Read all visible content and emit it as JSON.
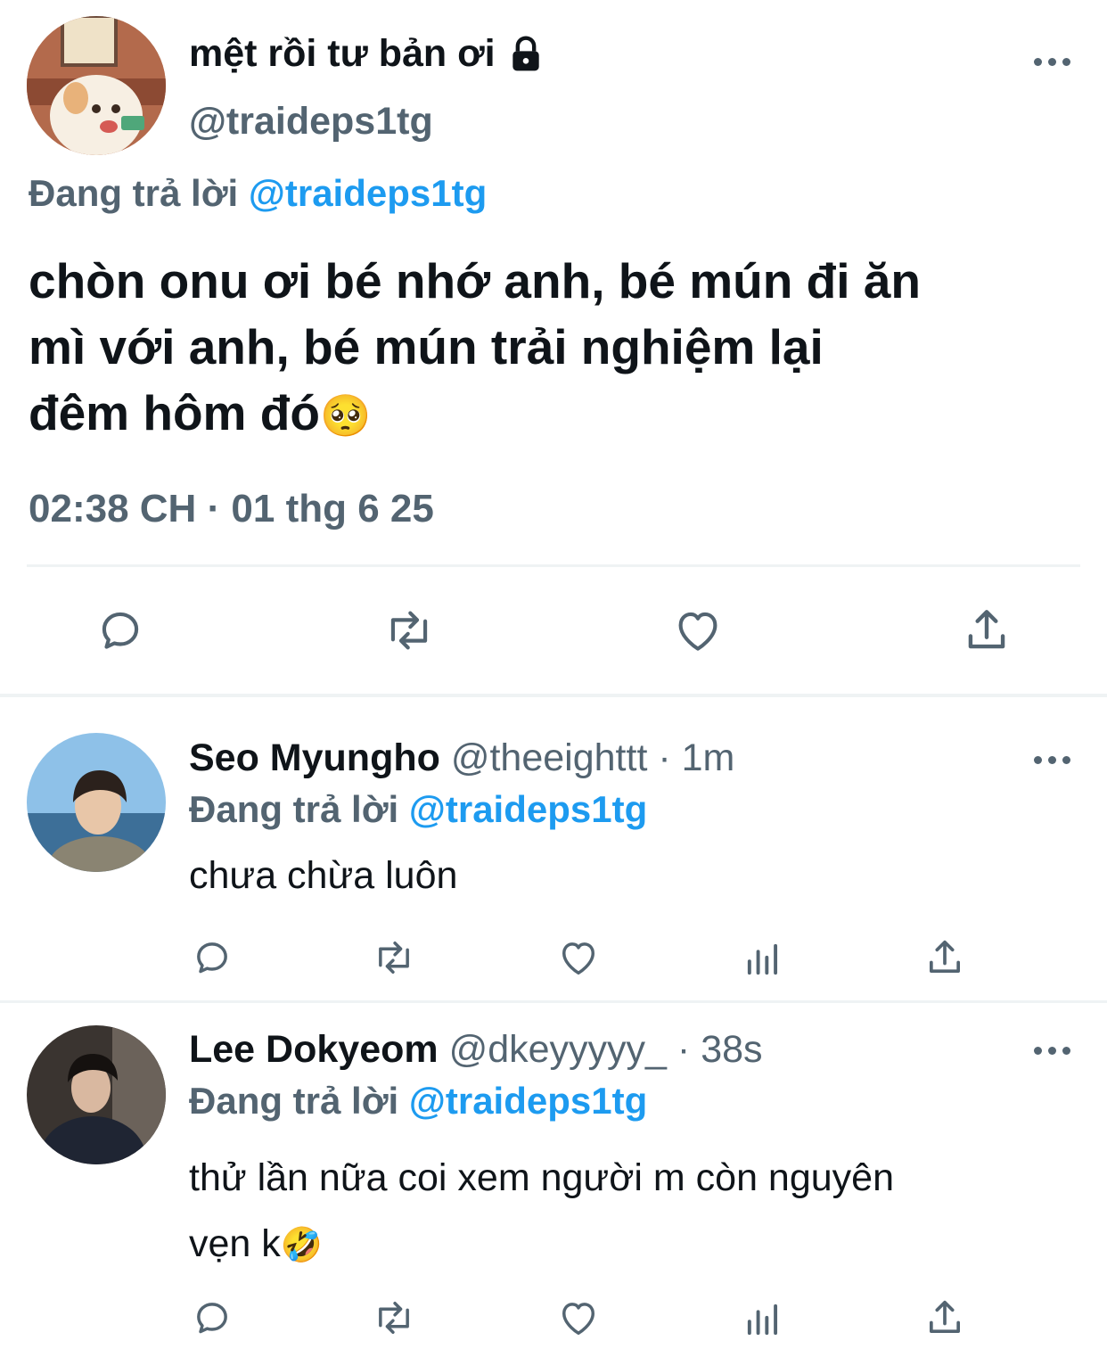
{
  "main_tweet": {
    "display_name": "mệt rồi tư bản ơi",
    "handle": "@traideps1tg",
    "replying_to_prefix": "Đang trả lời",
    "replying_to_handle": "@traideps1tg",
    "text_line1": "chòn onu ơi bé nhớ anh, bé mún đi ăn",
    "text_line2": "mì với anh, bé mún trải nghiệm lại",
    "text_line3": "đêm hôm đó",
    "emoji": "🥺",
    "timestamp": "02:38 CH · 01 thg 6 25",
    "actions": [
      "reply-icon",
      "retweet-icon",
      "like-icon",
      "share-icon"
    ],
    "lock_icon": "lock-icon"
  },
  "replies": [
    {
      "display_name": "Seo Myungho",
      "handle": "@theeighttt",
      "time": "· 1m",
      "replying_to_prefix": "Đang trả lời",
      "replying_to_handle": "@traideps1tg",
      "text_line1": "chưa chừa luôn",
      "text_line2": "",
      "emoji": ""
    },
    {
      "display_name": "Lee Dokyeom",
      "handle": "@dkeyyyyy_",
      "time": "· 38s",
      "replying_to_prefix": "Đang trả lời",
      "replying_to_handle": "@traideps1tg",
      "text_line1": "thử lần nữa coi xem người m còn nguyên",
      "text_line2": "vẹn k",
      "emoji": "🤣"
    }
  ],
  "colors": {
    "accent": "#1d9bf0",
    "secondary_text": "#536471",
    "divider": "#eff3f4",
    "icon": "#536471"
  }
}
